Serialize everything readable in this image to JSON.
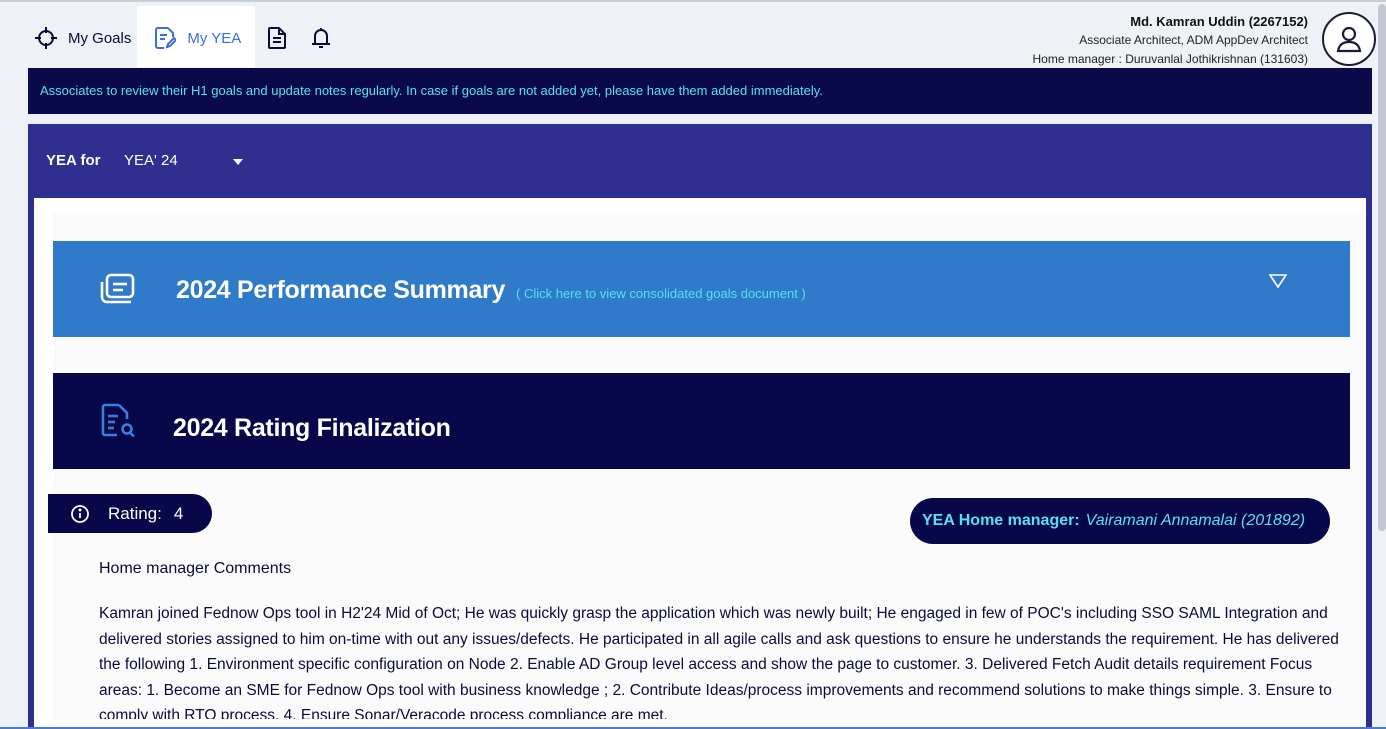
{
  "tabs": [
    {
      "label": "My Goals",
      "icon": "crosshair-icon"
    },
    {
      "label": "My YEA",
      "icon": "document-edit-icon"
    },
    {
      "label": "",
      "icon": "document-icon"
    },
    {
      "label": "",
      "icon": "bell-icon"
    }
  ],
  "user": {
    "name": "Md. Kamran Uddin (2267152)",
    "role": "Associate Architect, ADM AppDev Architect",
    "home_manager": "Home manager : Duruvanlal Jothikrishnan (131603)"
  },
  "notice": "Associates to review their H1 goals and update notes regularly. In case if goals are not added yet, please have them added immediately.",
  "yea": {
    "label": "YEA for",
    "selected": "YEA' 24"
  },
  "performance_summary": {
    "title": "2024 Performance Summary",
    "link": "( Click here to view consolidated goals document )"
  },
  "rating_finalization": {
    "title": "2024 Rating Finalization",
    "rating_label": "Rating:",
    "rating_value": "4",
    "manager_label": "YEA Home manager:",
    "manager_value": "Vairamani Annamalai (201892)",
    "comments_title": "Home manager Comments",
    "comments": "Kamran joined Fednow Ops tool in H2'24 Mid of Oct; He was quickly grasp the application which was newly built; He engaged in few of POC's including SSO SAML Integration and delivered stories assigned to him on-time with out any issues/defects. He participated in all agile calls and ask questions to ensure he understands the requirement. He has delivered the following 1. Environment specific configuration on Node 2. Enable AD Group level access and show the page to customer. 3. Delivered Fetch Audit details requirement Focus areas: 1. Become an SME for Fednow Ops tool with business knowledge ; 2. Contribute Ideas/process improvements and recommend solutions to make things simple. 3. Ensure to comply with RTO process. 4. Ensure Sonar/Veracode process compliance are met."
  },
  "colors": {
    "navy": "#07074a",
    "indigo": "#2e2f8f",
    "blue_panel": "#2f7ac9",
    "cyan_text": "#57e1f0",
    "active_tab_text": "#3a6fd8"
  }
}
